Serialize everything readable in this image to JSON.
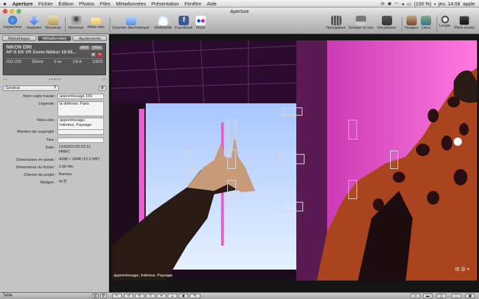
{
  "menubar": {
    "apple": "",
    "items": [
      "Aperture",
      "Fichier",
      "Édition",
      "Photos",
      "Piles",
      "Métadonnées",
      "Présentation",
      "Fenêtre",
      "Aide"
    ],
    "battery": "(100 %)",
    "clock": "jeu. 14:08",
    "user": "apple"
  },
  "window": {
    "title": "Aperture"
  },
  "toolbar": {
    "inspecteur": "Inspecteur",
    "importer": "Importer",
    "nouveau": "Nouveau",
    "nommer": "Nommer",
    "mots_cles": "Mots-clés",
    "courrier": "Courrier électronique",
    "mobileme": "MobileMe",
    "facebook": "Facebook",
    "flickr": "Flickr",
    "navigateur": "Navigateur",
    "scinder": "Scinder la vue",
    "visualiseur": "Visualiseur",
    "visages": "Visages",
    "lieux": "Lieux",
    "loupe": "Loupe",
    "plein_ecran": "Plein écran"
  },
  "tabs": [
    "Bibliothèque",
    "Métadonnées",
    "Ajustements"
  ],
  "camera": {
    "model": "NIKON D90",
    "lens": "AF-S DX VR Zoom-Nikkor 18-55...",
    "awb": "AWB",
    "format": "JPEG",
    "iso": "ISO 200",
    "focal": "55mm",
    "ev": "0 ev",
    "aperture": "ƒ/5.6",
    "shutter": "1/800"
  },
  "preset": {
    "selected": "Général"
  },
  "fields": {
    "version_name": {
      "label": "Nom copie travail :",
      "value": "apprentissage 160"
    },
    "caption": {
      "label": "Légende :",
      "value": "la défense, Paris"
    },
    "keywords": {
      "label": "Mots-clés :",
      "value1": "apprentissage,",
      "value2": "Intérieur, Paysage"
    },
    "copyright": {
      "label": "Mention de copyright :",
      "value": ""
    },
    "title": {
      "label": "Titre :",
      "value": ""
    },
    "date": {
      "label": "Date :",
      "value1": "12/03/10 00:22:31",
      "value2": "HNEC"
    },
    "pixel_size": {
      "label": "Dimensions en pixels :",
      "value": "4288 × 2848 (12,2 MP)"
    },
    "file_size": {
      "label": "Dimensions du fichier :",
      "value": "2,60 Mo"
    },
    "project_path": {
      "label": "Chemin du projet :",
      "value": "Bureau"
    },
    "badges": {
      "label": "Badges :",
      "value": ""
    }
  },
  "photo": {
    "caption": "apprentissage, Intérieur, Paysage"
  },
  "bottombar": {
    "table": "Table"
  }
}
